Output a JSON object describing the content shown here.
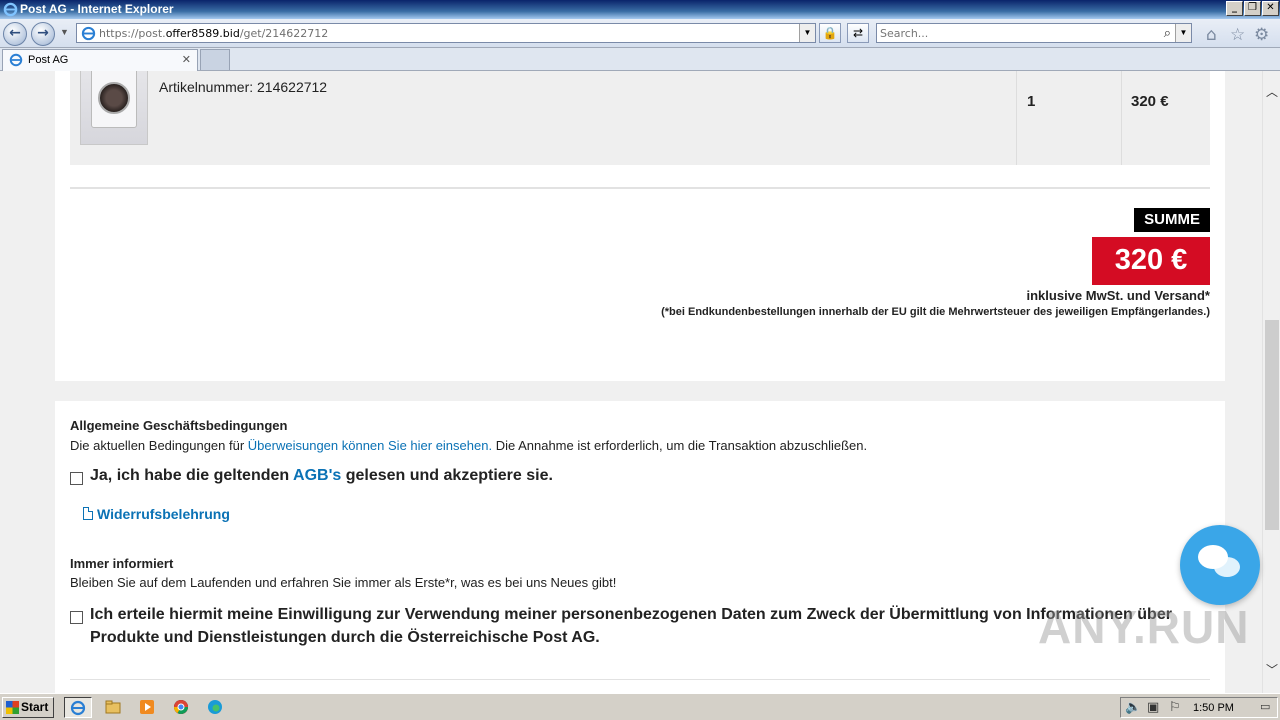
{
  "window": {
    "title": "Post AG - Internet Explorer",
    "minimize_label": "_",
    "restore_label": "❐",
    "close_label": "✕"
  },
  "address_bar": {
    "url_prefix": "https://post.",
    "url_domain": "offer8589.bid",
    "url_path": "/get/214622712",
    "search_placeholder": "Search..."
  },
  "tabs": [
    {
      "label": "Post AG",
      "close": "✕"
    }
  ],
  "order": {
    "article_number": "Artikelnummer: 214622712",
    "quantity": "1",
    "line_price": "320 €"
  },
  "summary": {
    "label": "SUMME",
    "total": "320 €",
    "vat_note": "inklusive MwSt. und Versand*",
    "eu_note": "(*bei Endkundenbestellungen innerhalb der EU gilt die Mehrwertsteuer des jeweiligen Empfängerlandes.)"
  },
  "terms": {
    "heading": "Allgemeine Geschäftsbedingungen",
    "text_before": "Die aktuellen Bedingungen für ",
    "text_link": "Überweisungen können Sie hier einsehen.",
    "text_after": " Die Annahme ist erforderlich, um die Transaktion abzuschließen.",
    "checkbox_before": "Ja, ich habe die geltenden ",
    "checkbox_link": "AGB's",
    "checkbox_after": " gelesen und akzeptiere sie.",
    "revocation_link": "Widerrufsbelehrung"
  },
  "newsletter": {
    "heading": "Immer informiert",
    "text": "Bleiben Sie auf dem Laufenden und erfahren Sie immer als Erste*r, was es bei uns Neues gibt!",
    "consent_line1": "Ich erteile hiermit meine Einwilligung zur Verwendung meiner personenbezogenen Daten zum Zweck der Übermittlung von Informationen über",
    "consent_line2": "Produkte und Dienstleistungen durch die Österreichische Post AG."
  },
  "watermark": "ANY.RUN",
  "taskbar": {
    "start_label": "Start",
    "clock": "1:50 PM"
  },
  "colors": {
    "accent_red": "#d40c23",
    "link_blue": "#0b72b5",
    "chat_blue": "#3aa6e8"
  },
  "icons": [
    "ie-logo-icon",
    "back-icon",
    "forward-icon",
    "lock-icon",
    "refresh-icon",
    "search-icon",
    "home-icon",
    "favorites-star-icon",
    "settings-gear-icon",
    "document-icon",
    "chat-icon",
    "windows-flag-icon",
    "explorer-folder-icon",
    "media-player-icon",
    "chrome-icon",
    "edge-icon",
    "volume-icon",
    "network-icon",
    "action-center-flag-icon"
  ]
}
